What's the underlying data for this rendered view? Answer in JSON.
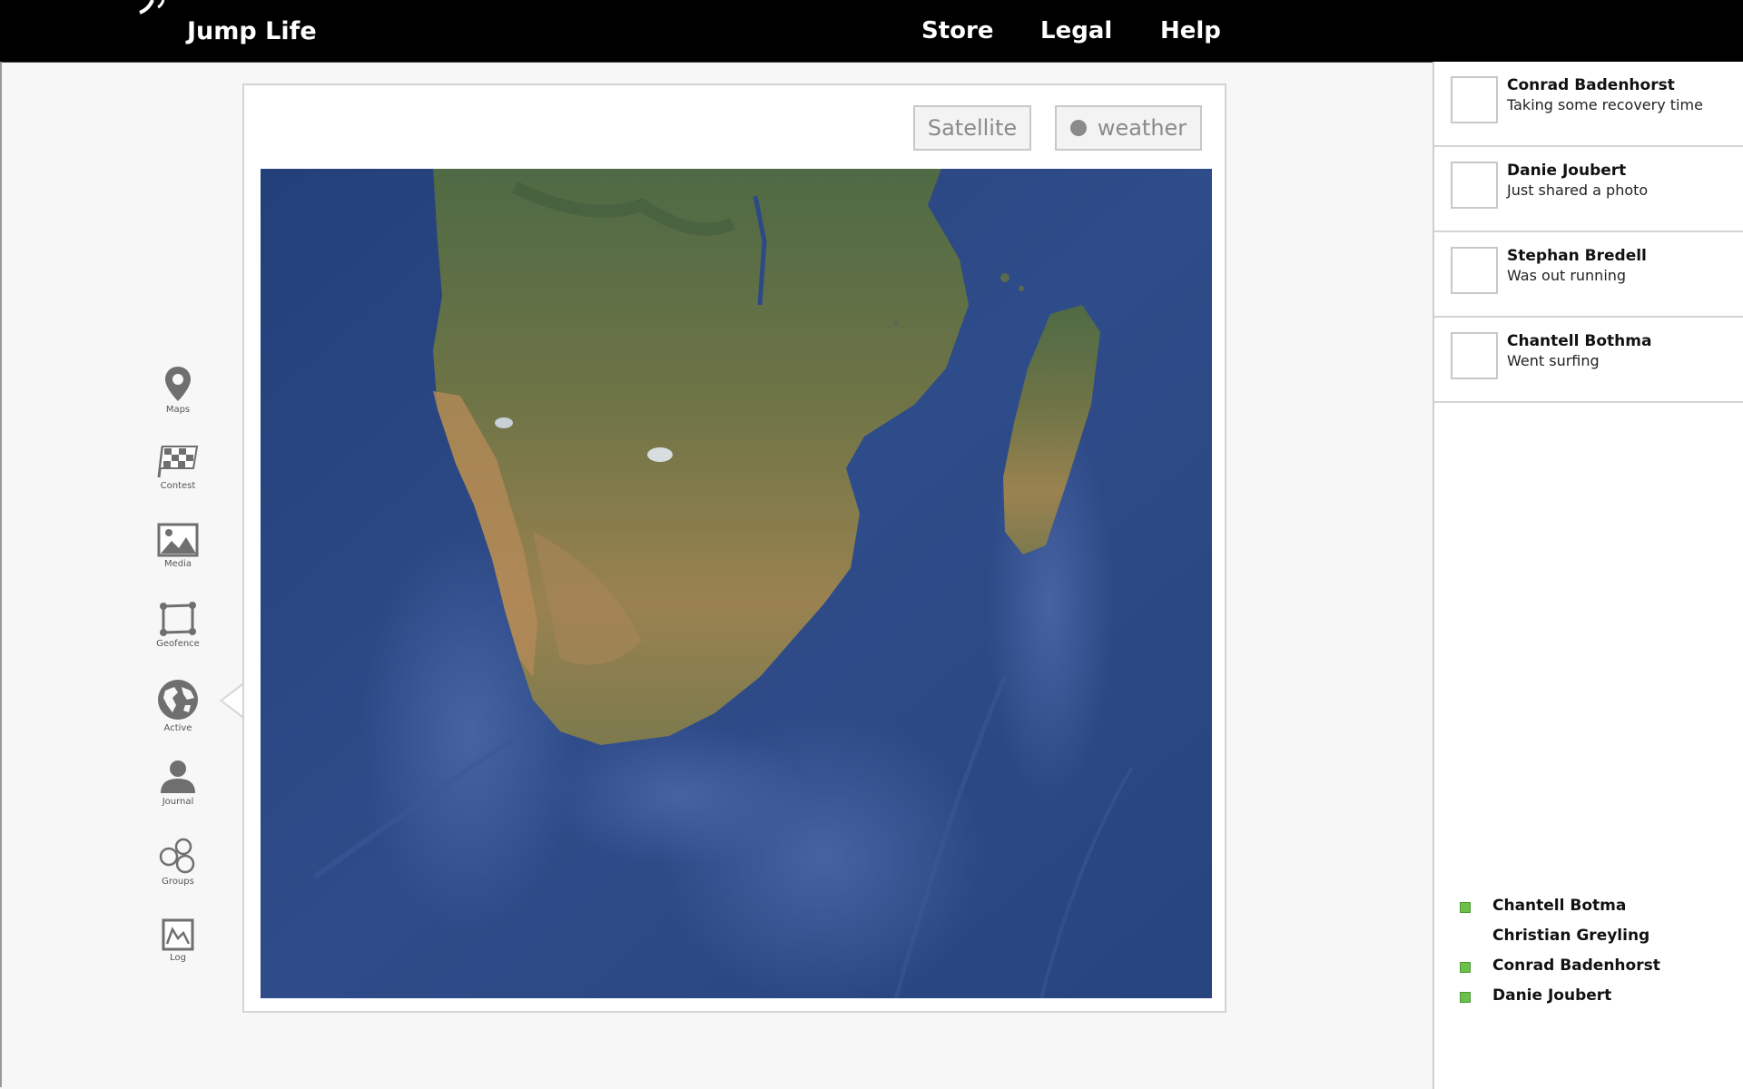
{
  "header": {
    "app_title": "Jump Life",
    "nav": [
      {
        "label": "Store"
      },
      {
        "label": "Legal"
      },
      {
        "label": "Help"
      }
    ]
  },
  "rail": {
    "items": [
      {
        "label": "Maps",
        "icon": "map-pin-icon"
      },
      {
        "label": "Contest",
        "icon": "checkered-flag-icon"
      },
      {
        "label": "Media",
        "icon": "image-icon"
      },
      {
        "label": "Geofence",
        "icon": "geofence-icon"
      },
      {
        "label": "Active",
        "icon": "globe-icon"
      },
      {
        "label": "Journal",
        "icon": "person-icon"
      },
      {
        "label": "Groups",
        "icon": "groups-icon"
      },
      {
        "label": "Log",
        "icon": "log-chart-icon"
      }
    ],
    "active": "Active"
  },
  "map": {
    "satellite_label": "Satellite",
    "weather_label": "weather",
    "colors": {
      "ocean": "#2f4a86",
      "land": "#7a7a4c",
      "desert": "#b08a55"
    }
  },
  "feed": [
    {
      "name": "Conrad Badenhorst",
      "status": "Taking some recovery time"
    },
    {
      "name": "Danie Joubert",
      "status": "Just shared a photo"
    },
    {
      "name": "Stephan Bredell",
      "status": "Was out running"
    },
    {
      "name": "Chantell Bothma",
      "status": "Went surfing"
    }
  ],
  "online": [
    {
      "name": "Chantell Botma",
      "online": true
    },
    {
      "name": "Christian Greyling",
      "online": false
    },
    {
      "name": "Conrad Badenhorst",
      "online": true
    },
    {
      "name": "Danie Joubert",
      "online": true
    }
  ],
  "colors": {
    "online": "#6cc04a",
    "header_bg": "#000000"
  }
}
